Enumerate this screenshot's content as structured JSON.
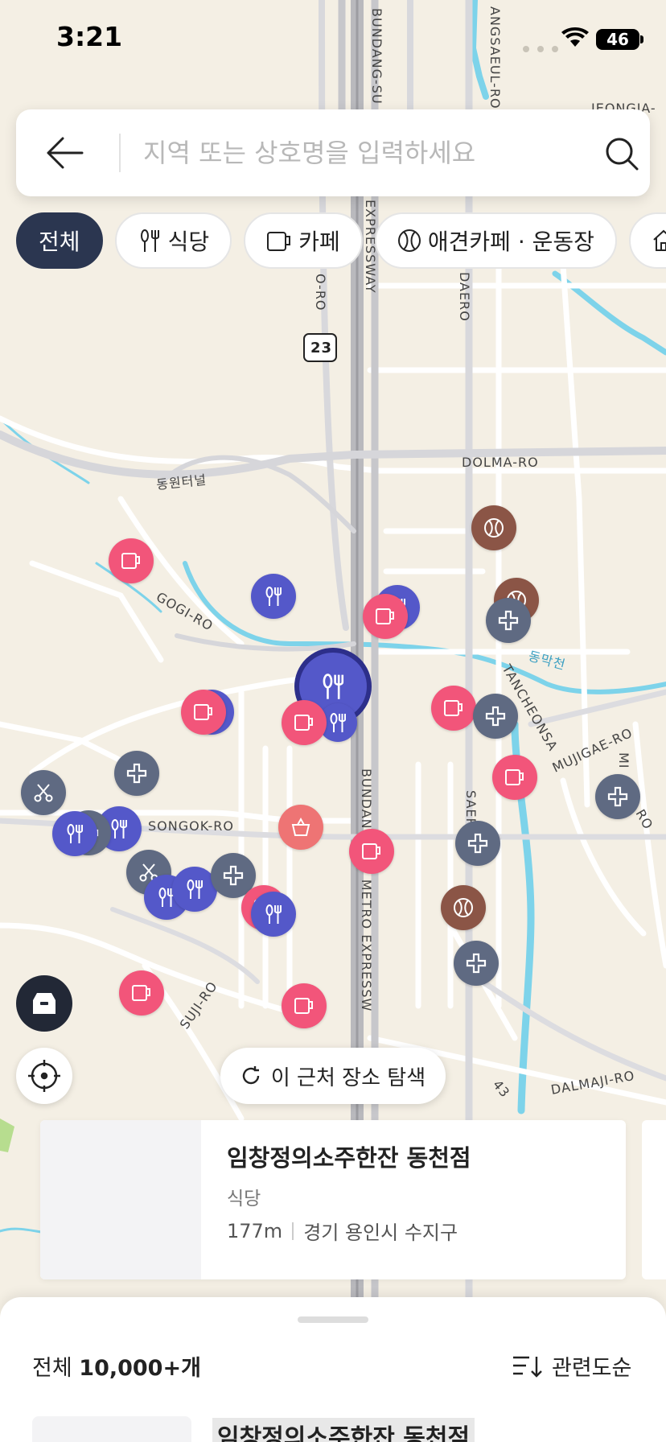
{
  "status": {
    "time": "3:21",
    "battery": "46"
  },
  "search": {
    "placeholder": "지역 또는 상호명을 입력하세요"
  },
  "categories": [
    {
      "label": "전체",
      "icon": "none",
      "active": true
    },
    {
      "label": "식당",
      "icon": "fork-knife-icon",
      "active": false
    },
    {
      "label": "카페",
      "icon": "cup-icon",
      "active": false
    },
    {
      "label": "애견카페 · 운동장",
      "icon": "ball-icon",
      "active": false
    },
    {
      "label": "",
      "icon": "home-icon",
      "active": false
    }
  ],
  "map": {
    "road_labels": [
      "BUNDANG-SU",
      "ANGSAEUL-RO",
      "JEONGJA-",
      "EXPRESSWAY",
      "DAERO",
      "O-RO",
      "23",
      "DOLMA-RO",
      "동원터널",
      "GOGI-RO",
      "동막천",
      "TANCHEONSA",
      "MUJIGAE-RO",
      "SONGOK-RO",
      "BUNDANG-SEO METRO EXPRESSW",
      "SUJI-RO",
      "DALMAJI-RO",
      "43",
      "MI",
      "RO",
      "SAERO"
    ],
    "pins": [
      {
        "type": "cafe"
      },
      {
        "type": "restaurant"
      },
      {
        "type": "restaurant"
      },
      {
        "type": "cafe"
      },
      {
        "type": "sports"
      },
      {
        "type": "sports"
      },
      {
        "type": "hospital"
      },
      {
        "type": "restaurant-selected"
      },
      {
        "type": "restaurant"
      },
      {
        "type": "cafe"
      },
      {
        "type": "restaurant"
      },
      {
        "type": "cafe"
      },
      {
        "type": "cafe"
      },
      {
        "type": "hospital"
      },
      {
        "type": "cafe"
      },
      {
        "type": "hospital"
      },
      {
        "type": "grooming"
      },
      {
        "type": "restaurant"
      },
      {
        "type": "hospital"
      },
      {
        "type": "restaurant"
      },
      {
        "type": "shopping"
      },
      {
        "type": "cafe"
      },
      {
        "type": "hospital"
      },
      {
        "type": "grooming"
      },
      {
        "type": "restaurant"
      },
      {
        "type": "restaurant"
      },
      {
        "type": "hospital"
      },
      {
        "type": "cafe"
      },
      {
        "type": "restaurant"
      },
      {
        "type": "sports"
      },
      {
        "type": "hospital"
      },
      {
        "type": "cafe"
      },
      {
        "type": "cafe"
      },
      {
        "type": "hospital"
      }
    ]
  },
  "explore": {
    "label": "이 근처 장소 탐색"
  },
  "place_card": {
    "name": "임창정의소주한잔 동천점",
    "category": "식당",
    "distance": "177m",
    "address": "경기 용인시 수지구"
  },
  "sheet": {
    "count_prefix": "전체",
    "count_value": "10,000+개",
    "sort_label": "관련도순",
    "first_item_title": "임창정의소주한잔 동천점"
  },
  "colors": {
    "cafe": "#f2557a",
    "restaurant": "#5458c9",
    "hospital": "#5f6a82",
    "sports": "#8b5546",
    "grooming": "#5f6a82",
    "shopping": "#ee7474",
    "chip_active": "#2b3650",
    "water": "#7dd3ea"
  }
}
